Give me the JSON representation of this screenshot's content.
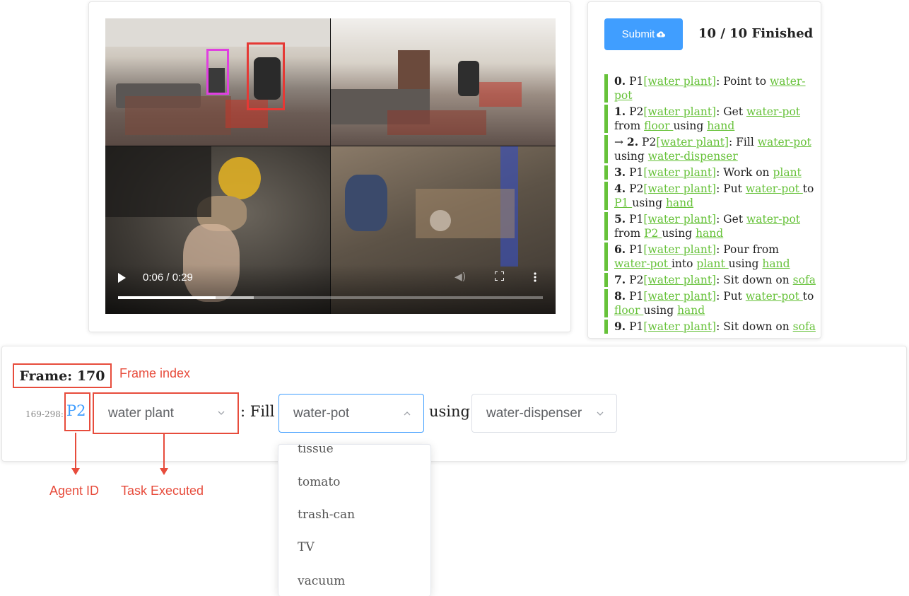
{
  "video": {
    "time": "0:06 / 0:29",
    "progress": 0.23,
    "buffered": 0.32,
    "controls": [
      "play-icon",
      "volume-icon",
      "fullscreen-icon",
      "more-options-icon"
    ]
  },
  "header": {
    "submit_label": "Submit",
    "submit_icon": "cloud-upload-icon",
    "finished_status": "10 / 10 Finished"
  },
  "tasks": [
    {
      "index": "0.",
      "agent": "P1",
      "task": "[water plant]",
      "text": ": Point to ",
      "obj": "water-pot"
    },
    {
      "index": "1.",
      "agent": "P2",
      "task": "[water plant]",
      "text": ": Get ",
      "obj": "water-pot",
      "mid": " from ",
      "obj2": "floor ",
      "mid2": "using ",
      "obj3": "hand"
    },
    {
      "arrow": "→ ",
      "index": "2.",
      "agent": "P2",
      "task": "[water plant]",
      "text": ": Fill ",
      "obj": "water-pot",
      "mid": " using ",
      "obj2": "water-dispenser"
    },
    {
      "index": "3.",
      "agent": "P1",
      "task": "[water plant]",
      "text": ": Work on ",
      "obj": "plant"
    },
    {
      "index": "4.",
      "agent": "P2",
      "task": "[water plant]",
      "text": ": Put ",
      "obj": "water-pot ",
      "mid": "to ",
      "obj2": "P1 ",
      "mid2": "using ",
      "obj3": "hand"
    },
    {
      "index": "5.",
      "agent": "P1",
      "task": "[water plant]",
      "text": ": Get ",
      "obj": "water-pot",
      "mid": " from ",
      "obj2": "P2 ",
      "mid2": "using ",
      "obj3": "hand"
    },
    {
      "index": "6.",
      "agent": "P1",
      "task": "[water plant]",
      "text": ": Pour from ",
      "obj": "water-pot ",
      "mid": "into ",
      "obj2": "plant ",
      "mid2": "using ",
      "obj3": "hand"
    },
    {
      "index": "7.",
      "agent": "P2",
      "task": "[water plant]",
      "text": ": Sit down on ",
      "obj": "sofa"
    },
    {
      "index": "8.",
      "agent": "P1",
      "task": "[water plant]",
      "text": ": Put ",
      "obj": "water-pot ",
      "mid": "to ",
      "obj2": "floor ",
      "mid2": "using ",
      "obj3": "hand"
    },
    {
      "index": "9.",
      "agent": "P1",
      "task": "[water plant]",
      "text": ": Sit down on ",
      "obj": "sofa"
    }
  ],
  "annotation": {
    "frame_label": "Frame: 170",
    "frame_index_callout": "Frame index",
    "frame_range": "169-298:",
    "agent_id": "P2",
    "task_value": "water plant",
    "verb": ": Fill",
    "object_value": "water-pot",
    "using": "using",
    "tool_value": "water-dispenser",
    "agent_id_callout": "Agent ID",
    "task_executed_callout": "Task Executed"
  },
  "dropdown": {
    "options": [
      "tissue",
      "tomato",
      "trash-can",
      "TV",
      "vacuum"
    ]
  },
  "colors": {
    "accent": "#409eff",
    "link": "#67c23a",
    "annotation_red": "#e74c3c"
  }
}
